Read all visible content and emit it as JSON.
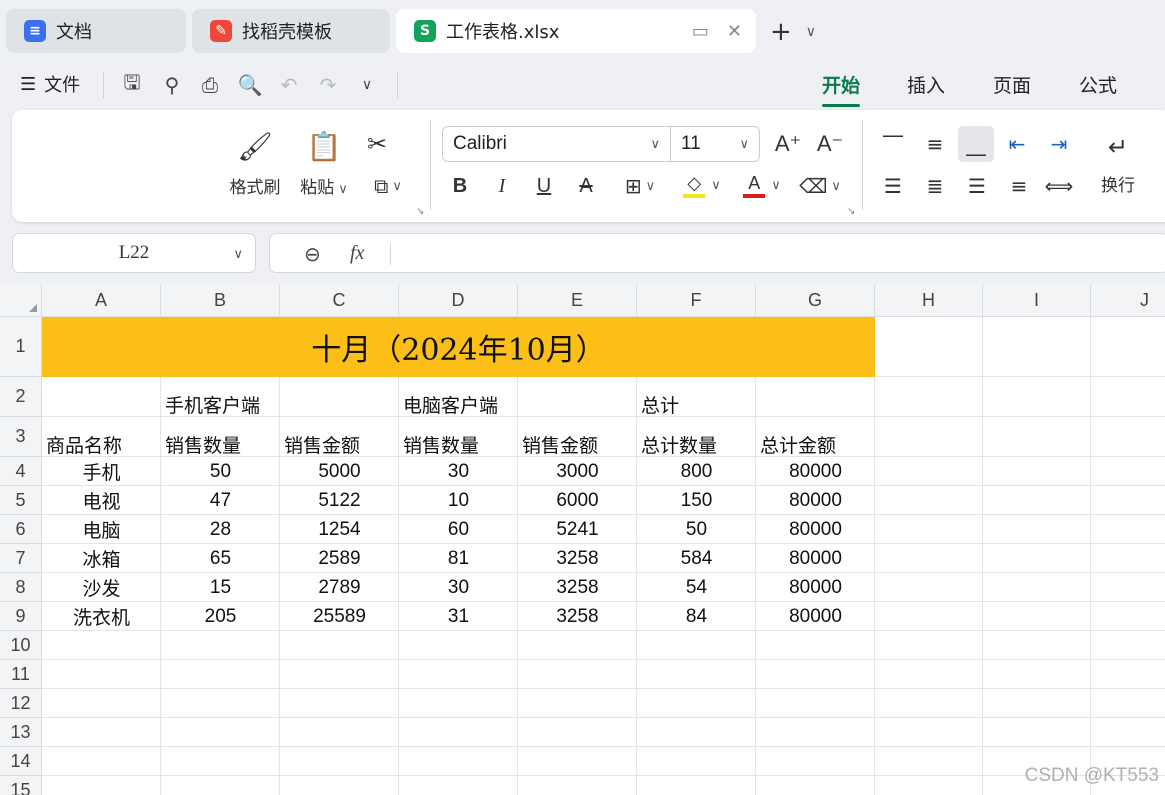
{
  "tabs": [
    {
      "label": "文档",
      "icon": "doc-icon",
      "color": "#3b6ff2"
    },
    {
      "label": "找稻壳模板",
      "icon": "docer-icon",
      "color": "#f0473b"
    },
    {
      "label": "工作表格.xlsx",
      "icon": "sheet-icon",
      "color": "#13a35a",
      "icon_text": "S"
    }
  ],
  "menu": {
    "file_label": "文件",
    "ribbon_tabs": [
      "开始",
      "插入",
      "页面",
      "公式"
    ],
    "active_tab": "开始"
  },
  "ribbon": {
    "format_painter": "格式刷",
    "paste": "粘贴",
    "font_name": "Calibri",
    "font_size": "11",
    "wrap_text": "换行",
    "highlight_color": "#f5e51b",
    "font_color": "#d91c1c"
  },
  "formula": {
    "name_box": "L22",
    "fx_label": "fx"
  },
  "grid": {
    "columns": [
      "A",
      "B",
      "C",
      "D",
      "E",
      "F",
      "G",
      "H",
      "I",
      "J"
    ],
    "rows": [
      "1",
      "2",
      "3",
      "4",
      "5",
      "6",
      "7",
      "8",
      "9",
      "10",
      "11",
      "12",
      "13",
      "14",
      "15"
    ],
    "title": "十月（2024年10月）",
    "title_fill": "#fbbf18",
    "group_headers": [
      "手机客户端",
      "电脑客户端",
      "总计"
    ],
    "column_headers": [
      "商品名称",
      "销售数量",
      "销售金额",
      "销售数量",
      "销售金额",
      "总计数量",
      "总计金额"
    ],
    "data": [
      [
        "手机",
        "50",
        "5000",
        "30",
        "3000",
        "800",
        "80000"
      ],
      [
        "电视",
        "47",
        "5122",
        "10",
        "6000",
        "150",
        "80000"
      ],
      [
        "电脑",
        "28",
        "1254",
        "60",
        "5241",
        "50",
        "80000"
      ],
      [
        "冰箱",
        "65",
        "2589",
        "81",
        "3258",
        "584",
        "80000"
      ],
      [
        "沙发",
        "15",
        "2789",
        "30",
        "3258",
        "54",
        "80000"
      ],
      [
        "洗衣机",
        "205",
        "25589",
        "31",
        "3258",
        "84",
        "80000"
      ]
    ]
  },
  "watermark": "CSDN @KT553",
  "accent": "#0c7a4a"
}
